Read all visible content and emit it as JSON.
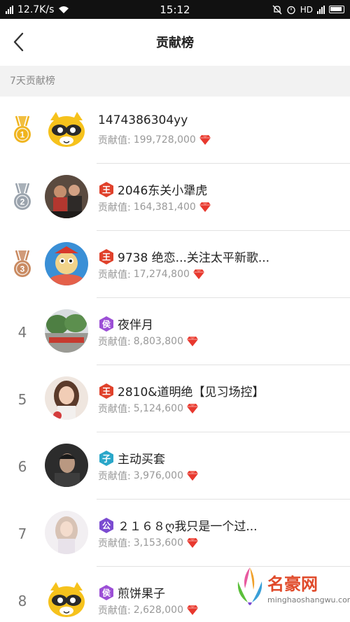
{
  "status_bar": {
    "speed": "12.7K/s",
    "time": "15:12",
    "hd_label": "HD"
  },
  "header": {
    "title": "贡献榜"
  },
  "section": {
    "label": "7天贡献榜"
  },
  "value_prefix": "贡献值:",
  "rows": [
    {
      "rank": "1",
      "medal": "gold",
      "name": "1474386304yy",
      "badge": "",
      "value": "199,728,000",
      "avatar": "mascot"
    },
    {
      "rank": "2",
      "medal": "silver",
      "name": "2046东关小犟虎",
      "badge": "王",
      "badge_color": "#e0412b",
      "value": "164,381,400",
      "avatar": "people"
    },
    {
      "rank": "3",
      "medal": "bronze",
      "name": "9738 绝恋...关注太平新歌...",
      "badge": "王",
      "badge_color": "#e0412b",
      "value": "17,274,800",
      "avatar": "cartoon"
    },
    {
      "rank": "4",
      "medal": "",
      "name": "夜伴月",
      "badge": "侯",
      "badge_color": "#9c4fd6",
      "value": "8,803,800",
      "avatar": "trees"
    },
    {
      "rank": "5",
      "medal": "",
      "name": "2810&道明绝【见习场控】",
      "badge": "王",
      "badge_color": "#e0412b",
      "value": "5,124,600",
      "avatar": "woman"
    },
    {
      "rank": "6",
      "medal": "",
      "name": "主动买套",
      "badge": "子",
      "badge_color": "#2aa7c9",
      "value": "3,976,000",
      "avatar": "man"
    },
    {
      "rank": "7",
      "medal": "",
      "name": "２１６８ღ我只是一个过...",
      "badge": "公",
      "badge_color": "#7b4bd1",
      "value": "3,153,600",
      "avatar": "girl"
    },
    {
      "rank": "8",
      "medal": "",
      "name": "煎饼果子",
      "badge": "侯",
      "badge_color": "#9c4fd6",
      "value": "2,628,000",
      "avatar": "mascot"
    }
  ],
  "watermark": {
    "text": "名豪网",
    "url": "minghaoshangwu.com"
  },
  "colors": {
    "gold": "#f0b41e",
    "silver": "#9aa3ad",
    "bronze": "#c98a61",
    "gem": "#e8382e"
  }
}
